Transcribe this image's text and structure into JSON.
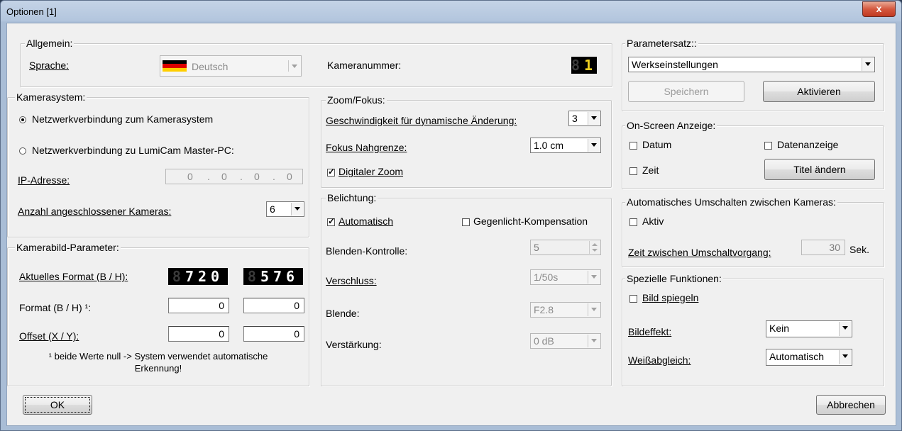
{
  "window": {
    "title": "Optionen [1]",
    "close_label": "x"
  },
  "general": {
    "legend": "Allgemein:",
    "language_label": "Sprache:",
    "language_value": "Deutsch",
    "camera_number_label": "Kameranummer:",
    "camera_number_value": "1"
  },
  "camera_system": {
    "legend": "Kamerasystem:",
    "radio_network": "Netzwerkverbindung zum Kamerasystem",
    "radio_lumicam": "Netzwerkverbindung zu LumiCam Master-PC:",
    "ip_label": "IP-Adresse:",
    "ip_octets": [
      "0",
      "0",
      "0",
      "0"
    ],
    "cameras_label": "Anzahl angeschlossener Kameras:",
    "cameras_value": "6"
  },
  "image_params": {
    "legend": "Kamerabild-Parameter:",
    "current_format_label": "Aktuelles Format (B / H):",
    "current_width": "720",
    "current_height": "576",
    "format_label": "Format (B / H) ¹:",
    "format_w": "0",
    "format_h": "0",
    "offset_label": "Offset (X / Y):",
    "offset_x": "0",
    "offset_y": "0",
    "footnote_line1": "¹ beide Werte null -> System verwendet automatische",
    "footnote_line2": "Erkennung!"
  },
  "zoom": {
    "legend": "Zoom/Fokus:",
    "speed_label": "Geschwindigkeit für dynamische Änderung:",
    "speed_value": "3",
    "focus_label": "Fokus Nahgrenze:",
    "focus_value": "1.0 cm",
    "digital_zoom_label": "Digitaler Zoom"
  },
  "exposure": {
    "legend": "Belichtung:",
    "auto_label": "Automatisch",
    "backlight_label": "Gegenlicht-Kompensation",
    "iris_control_label": "Blenden-Kontrolle:",
    "iris_control_value": "5",
    "shutter_label": "Verschluss:",
    "shutter_value": "1/50s",
    "iris_label": "Blende:",
    "iris_value": "F2.8",
    "gain_label": "Verstärkung:",
    "gain_value": "0 dB"
  },
  "paramset": {
    "legend": "Parametersatz::",
    "selected": "Werkseinstellungen",
    "save_label": "Speichern",
    "activate_label": "Aktivieren"
  },
  "osd": {
    "legend": "On-Screen Anzeige:",
    "date_label": "Datum",
    "data_label": "Datenanzeige",
    "time_label": "Zeit",
    "title_button": "Titel ändern"
  },
  "autoswitch": {
    "legend": "Automatisches Umschalten zwischen Kameras:",
    "active_label": "Aktiv",
    "interval_label": "Zeit zwischen Umschaltvorgang:",
    "interval_value": "30",
    "unit": "Sek."
  },
  "special": {
    "legend": "Spezielle Funktionen:",
    "mirror_label": "Bild spiegeln",
    "effect_label": "Bildeffekt:",
    "effect_value": "Kein",
    "wb_label": "Weißabgleich:",
    "wb_value": "Automatisch"
  },
  "footer": {
    "ok_label": "OK",
    "cancel_label": "Abbrechen"
  }
}
